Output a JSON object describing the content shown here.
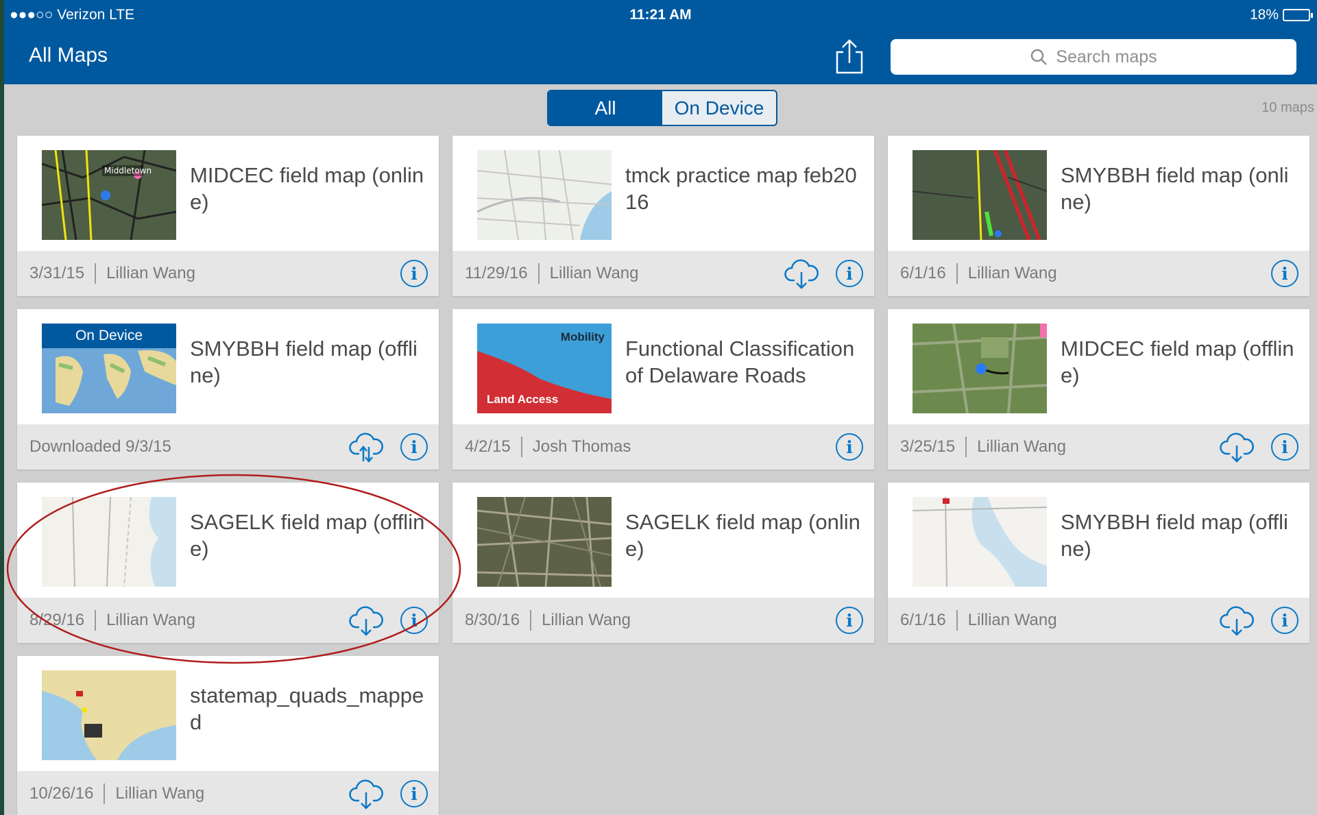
{
  "status_bar": {
    "carrier": "●●●○○ Verizon  LTE",
    "time": "11:21 AM",
    "battery": "18%",
    "battery_level": 0.18
  },
  "nav": {
    "title": "All Maps",
    "share_icon": "share-icon",
    "search_placeholder": "Search maps",
    "search_icon": "search-icon"
  },
  "segments": {
    "all": "All",
    "on_device": "On Device",
    "selected": "All"
  },
  "map_count": "10 maps",
  "maps": [
    {
      "title": "MIDCEC field map (online)",
      "date": "3/31/15",
      "author": "Lillian Wang",
      "download": false
    },
    {
      "title": "tmck practice map feb2016",
      "date": "11/29/16",
      "author": "Lillian Wang",
      "download": true
    },
    {
      "title": "SMYBBH field map (online)",
      "date": "6/1/16",
      "author": "Lillian Wang",
      "download": false
    },
    {
      "title": "SMYBBH field map (offline)",
      "footer": "Downloaded 9/3/15",
      "badge": "On Device",
      "sync": true
    },
    {
      "title": "Functional Classification of Delaware Roads",
      "date": "4/2/15",
      "author": "Josh Thomas",
      "download": false,
      "thumb_labels": [
        "Mobility",
        "Land Access"
      ]
    },
    {
      "title": "MIDCEC field map (offline)",
      "date": "3/25/15",
      "author": "Lillian Wang",
      "download": true
    },
    {
      "title": "SAGELK field map (offline)",
      "date": "8/29/16",
      "author": "Lillian Wang",
      "download": true
    },
    {
      "title": "SAGELK field map (online)",
      "date": "8/30/16",
      "author": "Lillian Wang",
      "download": false
    },
    {
      "title": "SMYBBH field map (offline)",
      "date": "6/1/16",
      "author": "Lillian Wang",
      "download": true
    },
    {
      "title": "statemap_quads_mapped",
      "date": "10/26/16",
      "author": "Lillian Wang",
      "download": true
    }
  ],
  "colors": {
    "brand": "#00599f",
    "info": "#0a78c8",
    "annotation": "#b01c1c"
  }
}
